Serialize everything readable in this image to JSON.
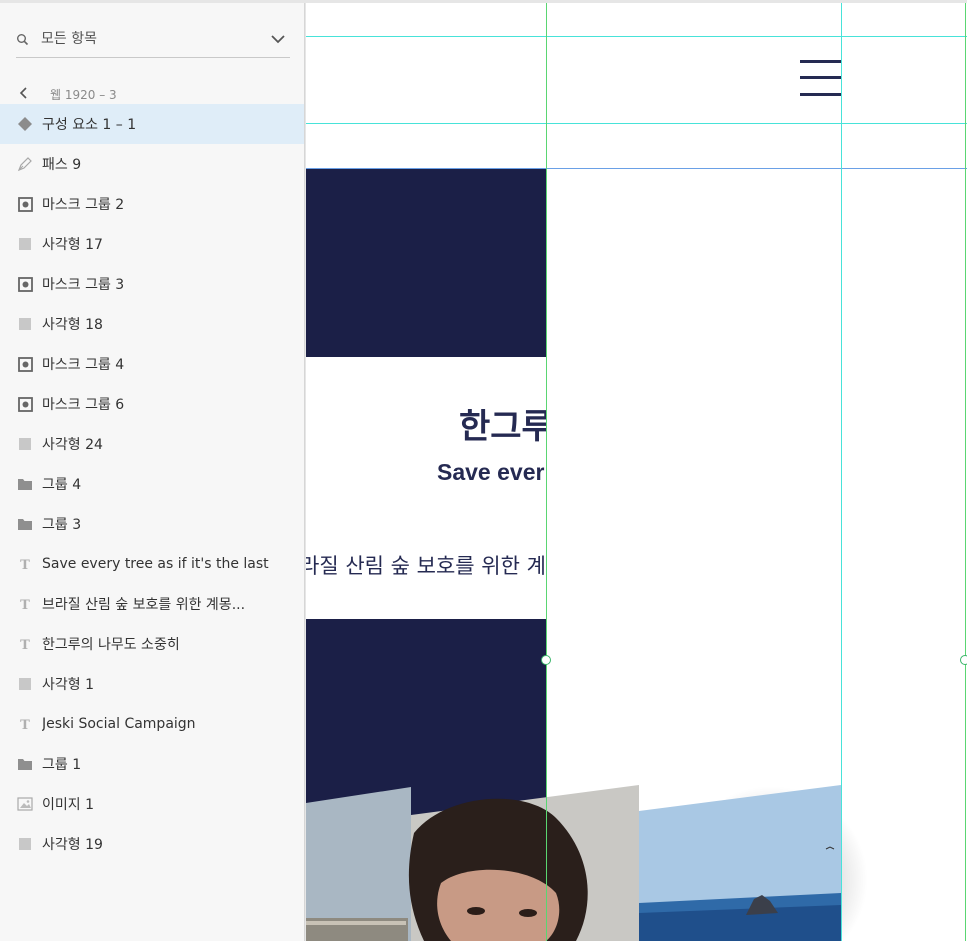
{
  "layers_panel": {
    "search": {
      "label": "모든 항목"
    },
    "breadcrumb": {
      "label": "웹 1920 – 3"
    },
    "items": [
      {
        "label": "구성 요소 1 – 1",
        "icon": "component-icon",
        "selected": true
      },
      {
        "label": "패스 9",
        "icon": "pen-path-icon"
      },
      {
        "label": "마스크 그룹 2",
        "icon": "mask-group-icon"
      },
      {
        "label": "사각형 17",
        "icon": "rectangle-icon"
      },
      {
        "label": "마스크 그룹 3",
        "icon": "mask-group-icon"
      },
      {
        "label": "사각형 18",
        "icon": "rectangle-icon"
      },
      {
        "label": "마스크 그룹 4",
        "icon": "mask-group-icon"
      },
      {
        "label": "마스크 그룹 6",
        "icon": "mask-group-icon"
      },
      {
        "label": "사각형 24",
        "icon": "rectangle-icon"
      },
      {
        "label": "그룹 4",
        "icon": "folder-icon"
      },
      {
        "label": "그룹 3",
        "icon": "folder-icon"
      },
      {
        "label": "Save every tree as if it's the last",
        "icon": "text-icon"
      },
      {
        "label": "브라질 산림 숲 보호를 위한 계몽...",
        "icon": "text-icon"
      },
      {
        "label": "한그루의 나무도 소중히",
        "icon": "text-icon"
      },
      {
        "label": "사각형 1",
        "icon": "rectangle-icon"
      },
      {
        "label": "Jeski Social Campaign",
        "icon": "text-icon"
      },
      {
        "label": "그룹 1",
        "icon": "folder-icon"
      },
      {
        "label": "이미지 1",
        "icon": "image-icon"
      },
      {
        "label": "사각형 19",
        "icon": "rectangle-icon"
      }
    ]
  },
  "canvas": {
    "hero_title": "한그루",
    "hero_subtitle": "Save ever",
    "hero_desc": "라질 산림 숲 보호를 위한 계",
    "colors": {
      "navy": "#1b1f47",
      "guide_cyan": "#48e3d9",
      "guide_green": "#5ad672",
      "selection": "#dfedf8"
    }
  }
}
